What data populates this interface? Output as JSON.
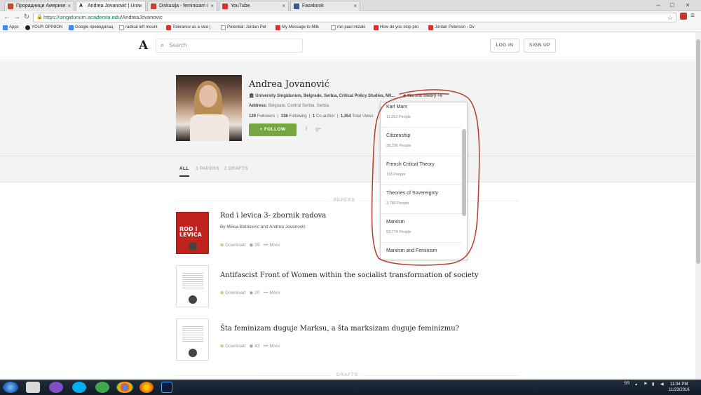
{
  "browser": {
    "tabs": [
      {
        "label": "Прорадници Америке"
      },
      {
        "label": "Andrea Jovanović | Univ"
      },
      {
        "label": "Diskusija - feminizam i"
      },
      {
        "label": "YouTube"
      },
      {
        "label": "Facebook"
      }
    ],
    "url_host": "https://singidunum.academia.edu",
    "url_path": "/AndreaJovanovic",
    "bookmarks": [
      "Apps",
      "YOUR OPINION",
      "Google преводилац",
      "radical left mount",
      "Tolerance as a vice |",
      "Potential: Jordan Pet",
      "My Message to Milk",
      "ron paul mizaki",
      "How do you stop pro",
      "Jordan Peterson - Dv"
    ]
  },
  "site": {
    "logo": "A",
    "search_placeholder": "Search",
    "login_label": "LOG IN",
    "signup_label": "SIGN UP"
  },
  "profile": {
    "name": "Andrea Jovanović",
    "affiliation": "University Singidunum, Belgrade, Serbia, Critical Policy Studies, Mil...",
    "address_label": "Address:",
    "address": "Belgrade, Central Serbia, Serbia",
    "followers_count": "129",
    "followers_label": "Followers",
    "following_count": "138",
    "following_label": "Following",
    "coauthor_count": "1",
    "coauthor_label": "Co-author",
    "views_count": "1,354",
    "views_label": "Total Views",
    "follow_label": "+ FOLLOW",
    "interest_tag": "Marxist theory",
    "interest_more": "+6"
  },
  "profile_tabs": [
    {
      "label": "ALL"
    },
    {
      "label": "3  PAPERS"
    },
    {
      "label": "2  DRAFTS"
    }
  ],
  "sections": {
    "papers": "PAPERS",
    "drafts": "DRAFTS"
  },
  "papers": [
    {
      "title": "Rod i levica 3- zbornik radova",
      "authors": "By Milica Batricevic and Andrea Jovanović",
      "download": "Download",
      "views": "39",
      "more": "More",
      "thumb_text": "ROD I LEVICA"
    },
    {
      "title": "Antifascist Front of Women within the socialist transformation of society",
      "authors": "",
      "download": "Download",
      "views": "20",
      "more": "More"
    },
    {
      "title": "Šta feminizam duguje Marksu, a šta marksizam duguje feminizmu?",
      "authors": "",
      "download": "Download",
      "views": "43",
      "more": "More"
    }
  ],
  "interests_dropdown": [
    {
      "name": "Karl Marx",
      "count": "11,352 People"
    },
    {
      "name": "Citizenship",
      "count": "38,296 People"
    },
    {
      "name": "French Critical Theory",
      "count": "118 People"
    },
    {
      "name": "Theories of Sovereignty",
      "count": "3,786 People"
    },
    {
      "name": "Marxism",
      "count": "53,774 People"
    },
    {
      "name": "Marxism and Feminism",
      "count": ""
    }
  ],
  "taskbar": {
    "lang": "SR",
    "time": "11:34 PM",
    "date": "11/23/2016"
  },
  "colors": {
    "follow_green": "#75a63f",
    "annotation_red": "#c0392b"
  }
}
